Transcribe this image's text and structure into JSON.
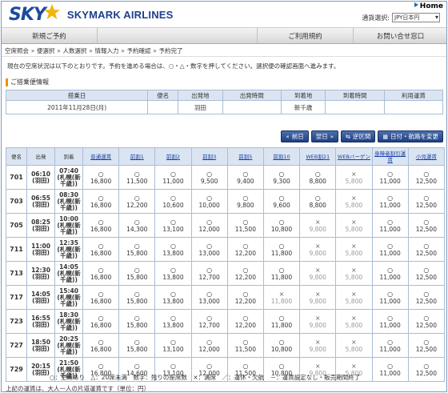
{
  "header": {
    "home_label": "Home",
    "logo_sky": "SKY",
    "logo_text": "SKYMARK AIRLINES",
    "currency_label": "通貨選択:",
    "currency_value": "JPY日本円"
  },
  "nav": {
    "items": [
      {
        "label": "新規ご予約",
        "width": 120
      },
      {
        "label": "",
        "width": 200
      },
      {
        "label": "ご利用規約",
        "width": 120
      },
      {
        "label": "お問い合せ窓口",
        "width": 118
      }
    ]
  },
  "steps": [
    "空席照会",
    "便選択",
    "人数選択",
    "情報入力",
    "予約確認",
    "予約完了"
  ],
  "instruction": "現在の空席状況は以下のとおりです。予約を進める場合は、○・△・数字を押してください。選択便の確認画面へ進みます。",
  "section_title": "ご搭乗便情報",
  "boarding_info": {
    "headers": [
      "搭乗日",
      "便名",
      "出発地",
      "出発時間",
      "到着地",
      "到着時間",
      "利用運賃"
    ],
    "values": [
      "2011年11月28日(月)",
      "",
      "羽田",
      "",
      "新千歳",
      "",
      ""
    ]
  },
  "buttons": {
    "prev_day": "前日",
    "next_day": "翌日",
    "reverse": "逆区間",
    "change": "日付・航路を変更"
  },
  "fare_table": {
    "headers": [
      "便名",
      "出発",
      "到着",
      "普通運賃",
      "前割1",
      "前割2",
      "前割3",
      "前割5",
      "前割10",
      "WEB割21",
      "WEBバーゲン",
      "身障者割引運賃",
      "小児運賃"
    ],
    "rows": [
      {
        "flight": "701",
        "dep": [
          "06:10",
          "(羽田)"
        ],
        "arr": [
          "07:40",
          "(札幌(新",
          "千歳))"
        ],
        "fares": [
          [
            "○",
            "16,800"
          ],
          [
            "○",
            "11,500"
          ],
          [
            "○",
            "11,000"
          ],
          [
            "○",
            "9,500"
          ],
          [
            "○",
            "9,400"
          ],
          [
            "○",
            "9,300"
          ],
          [
            "○",
            "8,800"
          ],
          [
            "×",
            "5,800"
          ],
          [
            "○",
            "11,000"
          ],
          [
            "○",
            "12,500"
          ]
        ]
      },
      {
        "flight": "703",
        "dep": [
          "06:55",
          "(羽田)"
        ],
        "arr": [
          "08:30",
          "(札幌(新",
          "千歳))"
        ],
        "fares": [
          [
            "○",
            "16,800"
          ],
          [
            "○",
            "12,200"
          ],
          [
            "○",
            "10,600"
          ],
          [
            "○",
            "10,000"
          ],
          [
            "○",
            "9,800"
          ],
          [
            "○",
            "9,600"
          ],
          [
            "○",
            "8,800"
          ],
          [
            "×",
            "5,800"
          ],
          [
            "○",
            "11,000"
          ],
          [
            "○",
            "12,500"
          ]
        ]
      },
      {
        "flight": "705",
        "dep": [
          "08:25",
          "(羽田)"
        ],
        "arr": [
          "10:00",
          "(札幌(新",
          "千歳))"
        ],
        "fares": [
          [
            "○",
            "16,800"
          ],
          [
            "○",
            "14,300"
          ],
          [
            "○",
            "13,100"
          ],
          [
            "○",
            "12,000"
          ],
          [
            "○",
            "11,500"
          ],
          [
            "○",
            "10,800"
          ],
          [
            "×",
            "9,800"
          ],
          [
            "×",
            "5,800"
          ],
          [
            "○",
            "11,000"
          ],
          [
            "○",
            "12,500"
          ]
        ]
      },
      {
        "flight": "711",
        "dep": [
          "11:00",
          "(羽田)"
        ],
        "arr": [
          "12:35",
          "(札幌(新",
          "千歳))"
        ],
        "fares": [
          [
            "○",
            "16,800"
          ],
          [
            "○",
            "15,800"
          ],
          [
            "○",
            "13,800"
          ],
          [
            "○",
            "13,000"
          ],
          [
            "○",
            "12,200"
          ],
          [
            "○",
            "11,800"
          ],
          [
            "×",
            "9,800"
          ],
          [
            "×",
            "5,800"
          ],
          [
            "○",
            "11,000"
          ],
          [
            "○",
            "12,500"
          ]
        ]
      },
      {
        "flight": "713",
        "dep": [
          "12:30",
          "(羽田)"
        ],
        "arr": [
          "14:05",
          "(札幌(新",
          "千歳))"
        ],
        "fares": [
          [
            "○",
            "16,800"
          ],
          [
            "○",
            "15,800"
          ],
          [
            "○",
            "13,800"
          ],
          [
            "○",
            "12,700"
          ],
          [
            "○",
            "12,200"
          ],
          [
            "○",
            "11,800"
          ],
          [
            "×",
            "9,800"
          ],
          [
            "×",
            "5,800"
          ],
          [
            "○",
            "11,000"
          ],
          [
            "○",
            "12,500"
          ]
        ]
      },
      {
        "flight": "717",
        "dep": [
          "14:05",
          "(羽田)"
        ],
        "arr": [
          "15:40",
          "(札幌(新",
          "千歳))"
        ],
        "fares": [
          [
            "○",
            "16,800"
          ],
          [
            "○",
            "15,800"
          ],
          [
            "○",
            "13,800"
          ],
          [
            "○",
            "13,000"
          ],
          [
            "○",
            "12,200"
          ],
          [
            "×",
            "11,800"
          ],
          [
            "×",
            "9,800"
          ],
          [
            "×",
            "5,800"
          ],
          [
            "○",
            "11,000"
          ],
          [
            "○",
            "12,500"
          ]
        ]
      },
      {
        "flight": "723",
        "dep": [
          "16:55",
          "(羽田)"
        ],
        "arr": [
          "18:30",
          "(札幌(新",
          "千歳))"
        ],
        "fares": [
          [
            "○",
            "16,800"
          ],
          [
            "○",
            "15,800"
          ],
          [
            "○",
            "13,800"
          ],
          [
            "○",
            "12,700"
          ],
          [
            "○",
            "12,200"
          ],
          [
            "○",
            "11,800"
          ],
          [
            "×",
            "9,800"
          ],
          [
            "×",
            "5,800"
          ],
          [
            "○",
            "11,000"
          ],
          [
            "○",
            "12,500"
          ]
        ]
      },
      {
        "flight": "727",
        "dep": [
          "18:50",
          "(羽田)"
        ],
        "arr": [
          "20:25",
          "(札幌(新",
          "千歳))"
        ],
        "fares": [
          [
            "○",
            "16,800"
          ],
          [
            "○",
            "15,800"
          ],
          [
            "○",
            "13,100"
          ],
          [
            "○",
            "12,000"
          ],
          [
            "○",
            "11,500"
          ],
          [
            "○",
            "10,800"
          ],
          [
            "×",
            "9,800"
          ],
          [
            "×",
            "5,800"
          ],
          [
            "○",
            "11,000"
          ],
          [
            "○",
            "12,500"
          ]
        ]
      },
      {
        "flight": "729",
        "dep": [
          "20:15",
          "(羽田)"
        ],
        "arr": [
          "21:50",
          "(札幌(新",
          "千歳))"
        ],
        "fares": [
          [
            "○",
            "16,800"
          ],
          [
            "○",
            "14,600"
          ],
          [
            "○",
            "13,100"
          ],
          [
            "○",
            "12,000"
          ],
          [
            "○",
            "11,500"
          ],
          [
            "○",
            "10,800"
          ],
          [
            "×",
            "9,800"
          ],
          [
            "×",
            "5,800"
          ],
          [
            "○",
            "11,000"
          ],
          [
            "○",
            "12,500"
          ]
        ]
      }
    ]
  },
  "legend": "○：空席あり　△：20席未満　数字：残りの座席数　×：満席　／：運休・欠航　－：運賃設定なし・販売期間終了",
  "note": "上記の運賃は、大人一人の片道運賃です（単位：円）",
  "colors": {
    "brand": "#1d4a9c",
    "star": "#f2b50f",
    "header_bg": "#dbe5f1",
    "button": "#2a4c8f"
  }
}
